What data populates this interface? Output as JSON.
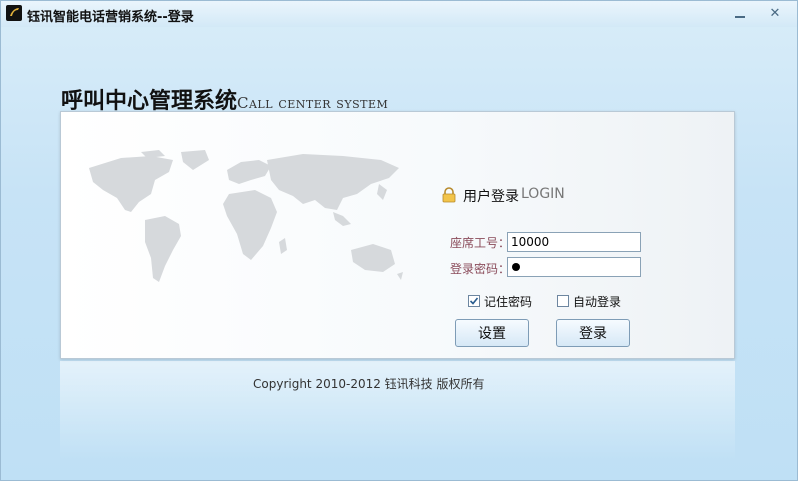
{
  "window": {
    "title": "钰讯智能电话营销系统--登录",
    "minimize_icon": "minimize-icon",
    "close_icon": "close-icon",
    "close_glyph": "✕"
  },
  "header": {
    "title_cn": "呼叫中心管理系统",
    "title_en": "Call center system"
  },
  "login": {
    "heading_cn": "用户登录",
    "heading_en": "LOGIN",
    "agent_id_label": "座席工号：",
    "agent_id_value": "10000",
    "password_label": "登录密码：",
    "remember_label": "记住密码",
    "remember_checked": true,
    "auto_login_label": "自动登录",
    "auto_login_checked": false,
    "settings_button": "设置",
    "login_button": "登录"
  },
  "footer": {
    "copyright": "Copyright 2010-2012   钰讯科技 版权所有"
  },
  "colors": {
    "background": "#c7e3f6",
    "label": "#8a4b5a",
    "button_border": "#7e9cb6"
  }
}
